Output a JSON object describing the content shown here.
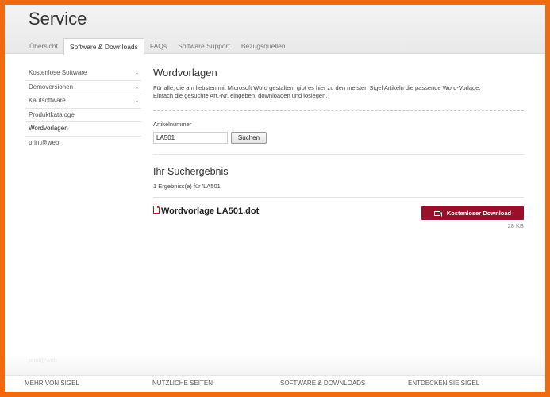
{
  "header": {
    "title": "Service",
    "tabs": [
      {
        "label": "Übersicht",
        "active": false
      },
      {
        "label": "Software & Downloads",
        "active": true
      },
      {
        "label": "FAQs",
        "active": false
      },
      {
        "label": "Software Support",
        "active": false
      },
      {
        "label": "Bezugsquellen",
        "active": false
      }
    ]
  },
  "sidebar": {
    "items": [
      {
        "label": "Kostenlose Software",
        "expandable": true
      },
      {
        "label": "Demoversionen",
        "expandable": true
      },
      {
        "label": "Kaufsoftware",
        "expandable": true
      },
      {
        "label": "Produktkataloge",
        "expandable": false
      },
      {
        "label": "Wordvorlagen",
        "expandable": false,
        "active": true
      },
      {
        "label": "print@web",
        "expandable": false
      }
    ]
  },
  "main": {
    "heading": "Wordvorlagen",
    "intro_line1": "Für alle, die am liebsten mit Microsoft Word gestalten, gibt es hier zu den meisten Sigel Artikeln die passende Word-Vorlage.",
    "intro_line2": "Einfach die gesuchte Art.-Nr. eingeben, downloaden und loslegen.",
    "search": {
      "label": "Artikelnummer",
      "value": "LA501",
      "button_label": "Suchen"
    },
    "results": {
      "heading": "Ihr Suchergebnis",
      "count_text": "1 Ergebniss(e) für 'LA501'",
      "items": [
        {
          "name": "Wordvorlage LA501.dot",
          "download_label": "Kostenloser Download",
          "size": "28 KB"
        }
      ]
    }
  },
  "footer": {
    "ghost_text": "print@web",
    "columns": [
      "MEHR VON SIGEL",
      "NÜTZLICHE SEITEN",
      "SOFTWARE & DOWNLOADS",
      "ENTDECKEN SIE SIGEL"
    ]
  },
  "colors": {
    "page_border": "#f26a10",
    "accent_button": "#98102a"
  }
}
